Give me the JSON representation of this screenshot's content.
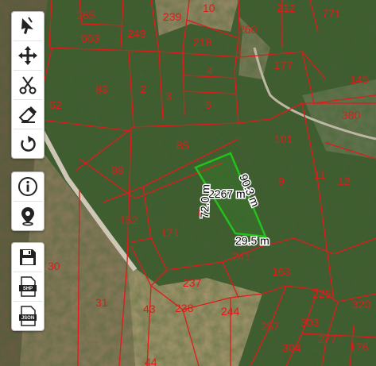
{
  "colors": {
    "parcel_border": "#e21a1a",
    "parcel_label": "#e21a1a",
    "selection": "#22c21a",
    "measure_text": "#000000"
  },
  "parcels": [
    {
      "id": "265",
      "label": "265"
    },
    {
      "id": "663",
      "label": "663"
    },
    {
      "id": "249",
      "label": "249"
    },
    {
      "id": "239",
      "label": "239"
    },
    {
      "id": "10",
      "label": "10"
    },
    {
      "id": "218",
      "label": "218"
    },
    {
      "id": "260",
      "label": "260"
    },
    {
      "id": "212",
      "label": "212"
    },
    {
      "id": "771",
      "label": "771"
    },
    {
      "id": "83",
      "label": "83"
    },
    {
      "id": "2",
      "label": "2"
    },
    {
      "id": "3",
      "label": "3"
    },
    {
      "id": "4",
      "label": "4"
    },
    {
      "id": "5",
      "label": "5"
    },
    {
      "id": "177",
      "label": "177"
    },
    {
      "id": "145",
      "label": "145"
    },
    {
      "id": "62",
      "label": "62"
    },
    {
      "id": "85",
      "label": "85"
    },
    {
      "id": "101",
      "label": "101"
    },
    {
      "id": "88",
      "label": "88"
    },
    {
      "id": "9",
      "label": "9"
    },
    {
      "id": "11",
      "label": "11"
    },
    {
      "id": "12",
      "label": "12"
    },
    {
      "id": "152",
      "label": "152"
    },
    {
      "id": "171",
      "label": "171"
    },
    {
      "id": "6",
      "label": "6"
    },
    {
      "id": "241",
      "label": "241"
    },
    {
      "id": "163",
      "label": "163"
    },
    {
      "id": "30",
      "label": "30"
    },
    {
      "id": "31",
      "label": "31"
    },
    {
      "id": "237",
      "label": "237"
    },
    {
      "id": "43",
      "label": "43"
    },
    {
      "id": "238",
      "label": "238"
    },
    {
      "id": "244",
      "label": "244"
    },
    {
      "id": "225",
      "label": "225"
    },
    {
      "id": "320",
      "label": "320"
    },
    {
      "id": "257",
      "label": "257"
    },
    {
      "id": "303",
      "label": "303"
    },
    {
      "id": "277",
      "label": "277"
    },
    {
      "id": "304",
      "label": "304"
    },
    {
      "id": "176",
      "label": "176"
    },
    {
      "id": "44",
      "label": "44"
    },
    {
      "id": "380",
      "label": "380"
    }
  ],
  "measurement": {
    "area": "2267 m²",
    "side_top_right": "90.3 m",
    "side_left": "72.0 m",
    "side_bottom": "29.5 m"
  },
  "toolbar": {
    "tools": [
      {
        "id": "select",
        "icon": "cursor-icon"
      },
      {
        "id": "pan",
        "icon": "move-arrows-icon"
      },
      {
        "id": "cut",
        "icon": "scissors-icon"
      },
      {
        "id": "erase",
        "icon": "eraser-icon"
      },
      {
        "id": "undo",
        "icon": "undo-icon"
      }
    ],
    "info_tools": [
      {
        "id": "info",
        "icon": "info-icon"
      },
      {
        "id": "locate",
        "icon": "location-pin-icon"
      }
    ],
    "file_tools": [
      {
        "id": "save",
        "icon": "save-icon"
      },
      {
        "id": "shp",
        "icon": "shp-file-icon",
        "label": "SHP"
      },
      {
        "id": "json",
        "icon": "json-file-icon",
        "label": "JSON"
      }
    ]
  }
}
